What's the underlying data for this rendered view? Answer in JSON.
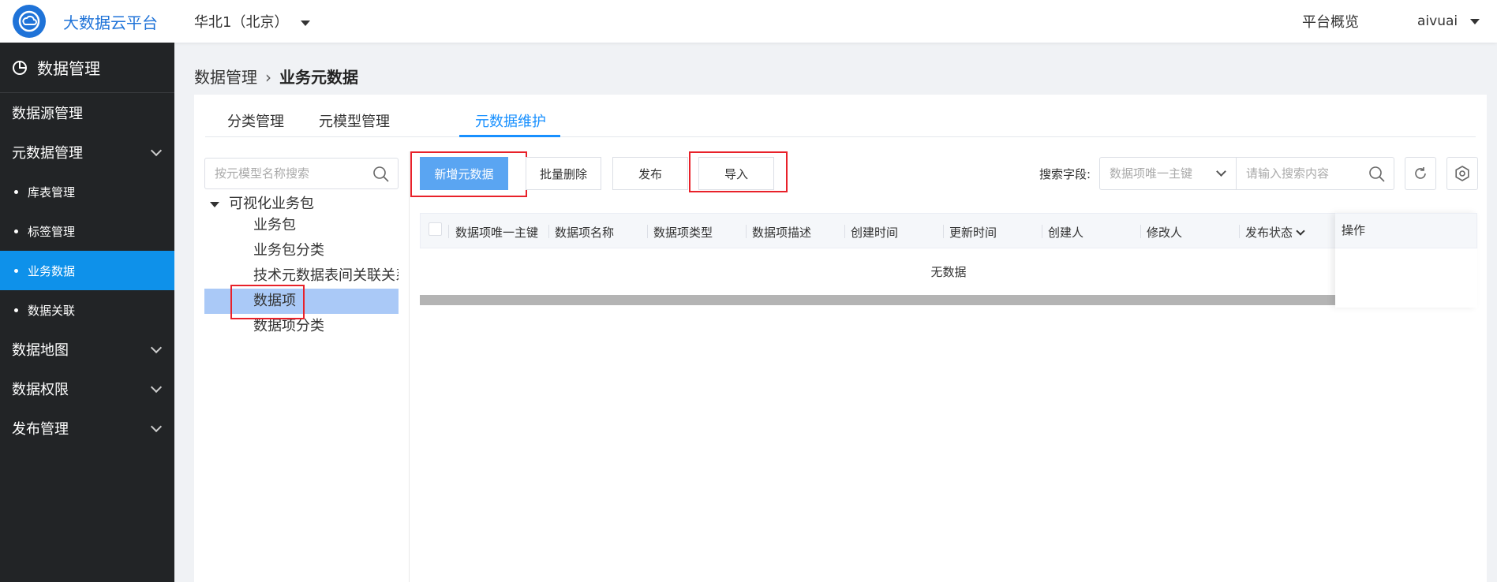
{
  "header": {
    "app_title": "大数据云平台",
    "region": "华北1（北京）",
    "overview": "平台概览",
    "user": "aivuai"
  },
  "sidebar": {
    "title": "数据管理",
    "items": [
      {
        "label": "数据源管理"
      },
      {
        "label": "元数据管理"
      },
      {
        "label": "库表管理"
      },
      {
        "label": "标签管理"
      },
      {
        "label": "业务数据"
      },
      {
        "label": "数据关联"
      },
      {
        "label": "数据地图"
      },
      {
        "label": "数据权限"
      },
      {
        "label": "发布管理"
      }
    ]
  },
  "breadcrumb": {
    "parent": "数据管理",
    "separator": "›",
    "current": "业务元数据"
  },
  "tabs": [
    {
      "label": "分类管理"
    },
    {
      "label": "元模型管理"
    },
    {
      "label": "元数据维护",
      "active": true
    }
  ],
  "tree": {
    "search_placeholder": "按元模型名称搜索",
    "root": "可视化业务包",
    "nodes": [
      {
        "label": "业务包"
      },
      {
        "label": "业务包分类"
      },
      {
        "label": "技术元数据表间关联关系"
      },
      {
        "label": "数据项",
        "selected": true
      },
      {
        "label": "数据项分类"
      }
    ]
  },
  "toolbar": {
    "add_label": "新增元数据",
    "batch_delete_label": "批量删除",
    "publish_label": "发布",
    "import_label": "导入",
    "search_field_label": "搜索字段:",
    "field_select_value": "数据项唯一主键",
    "content_placeholder": "请输入搜索内容"
  },
  "table": {
    "columns": [
      "数据项唯一主键",
      "数据项名称",
      "数据项类型",
      "数据项描述",
      "创建时间",
      "更新时间",
      "创建人",
      "修改人",
      "发布状态"
    ],
    "actions_header": "操作",
    "empty_text": "无数据"
  },
  "colors": {
    "brand": "#1f73d8",
    "active_menu": "#0e91ea",
    "primary_button": "#5aa5f2",
    "highlight_box": "#e8212a",
    "tree_selected": "#aac9f7"
  }
}
